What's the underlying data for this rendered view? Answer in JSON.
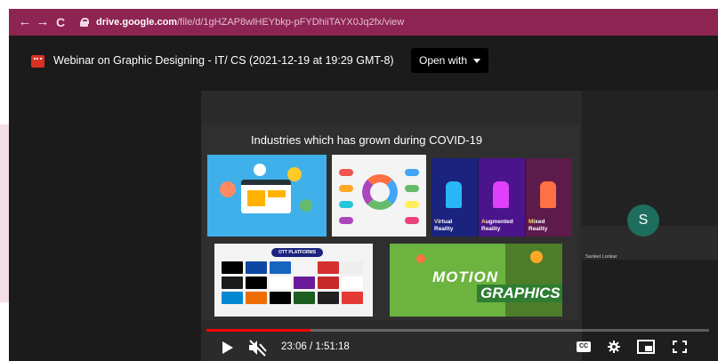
{
  "browser": {
    "url_host": "drive.google.com",
    "url_path": "/file/d/1gHZAP8wlHEYbkp-pFYDhiiTAYX0Jq2fx/view"
  },
  "viewer": {
    "title": "Webinar on Graphic Designing - IT/ CS (2021-12-19 at 19:29 GMT-8)",
    "open_with": "Open with"
  },
  "slide": {
    "title": "Industries which has grown during COVID-19",
    "panels": [
      {
        "first": "V",
        "rest": "irtual",
        "second": "Reality"
      },
      {
        "first": "A",
        "rest": "ugmented",
        "second": "Reality"
      },
      {
        "first": "M",
        "rest": "ixed",
        "second": "Reality"
      }
    ],
    "ott_header": "OTT PLATFORMS",
    "motion_word1": "MOTION",
    "motion_word2": "GRAPHICS"
  },
  "participant": {
    "initial": "S",
    "name": "Sanket Lonkar"
  },
  "player": {
    "time": "23:06 / 1:51:18",
    "progress": 0.207,
    "cc_label": "CC"
  },
  "colors": {
    "chrome_bar": "#8d2452",
    "progress": "#ff0000",
    "avatar": "#1e6e5e"
  }
}
